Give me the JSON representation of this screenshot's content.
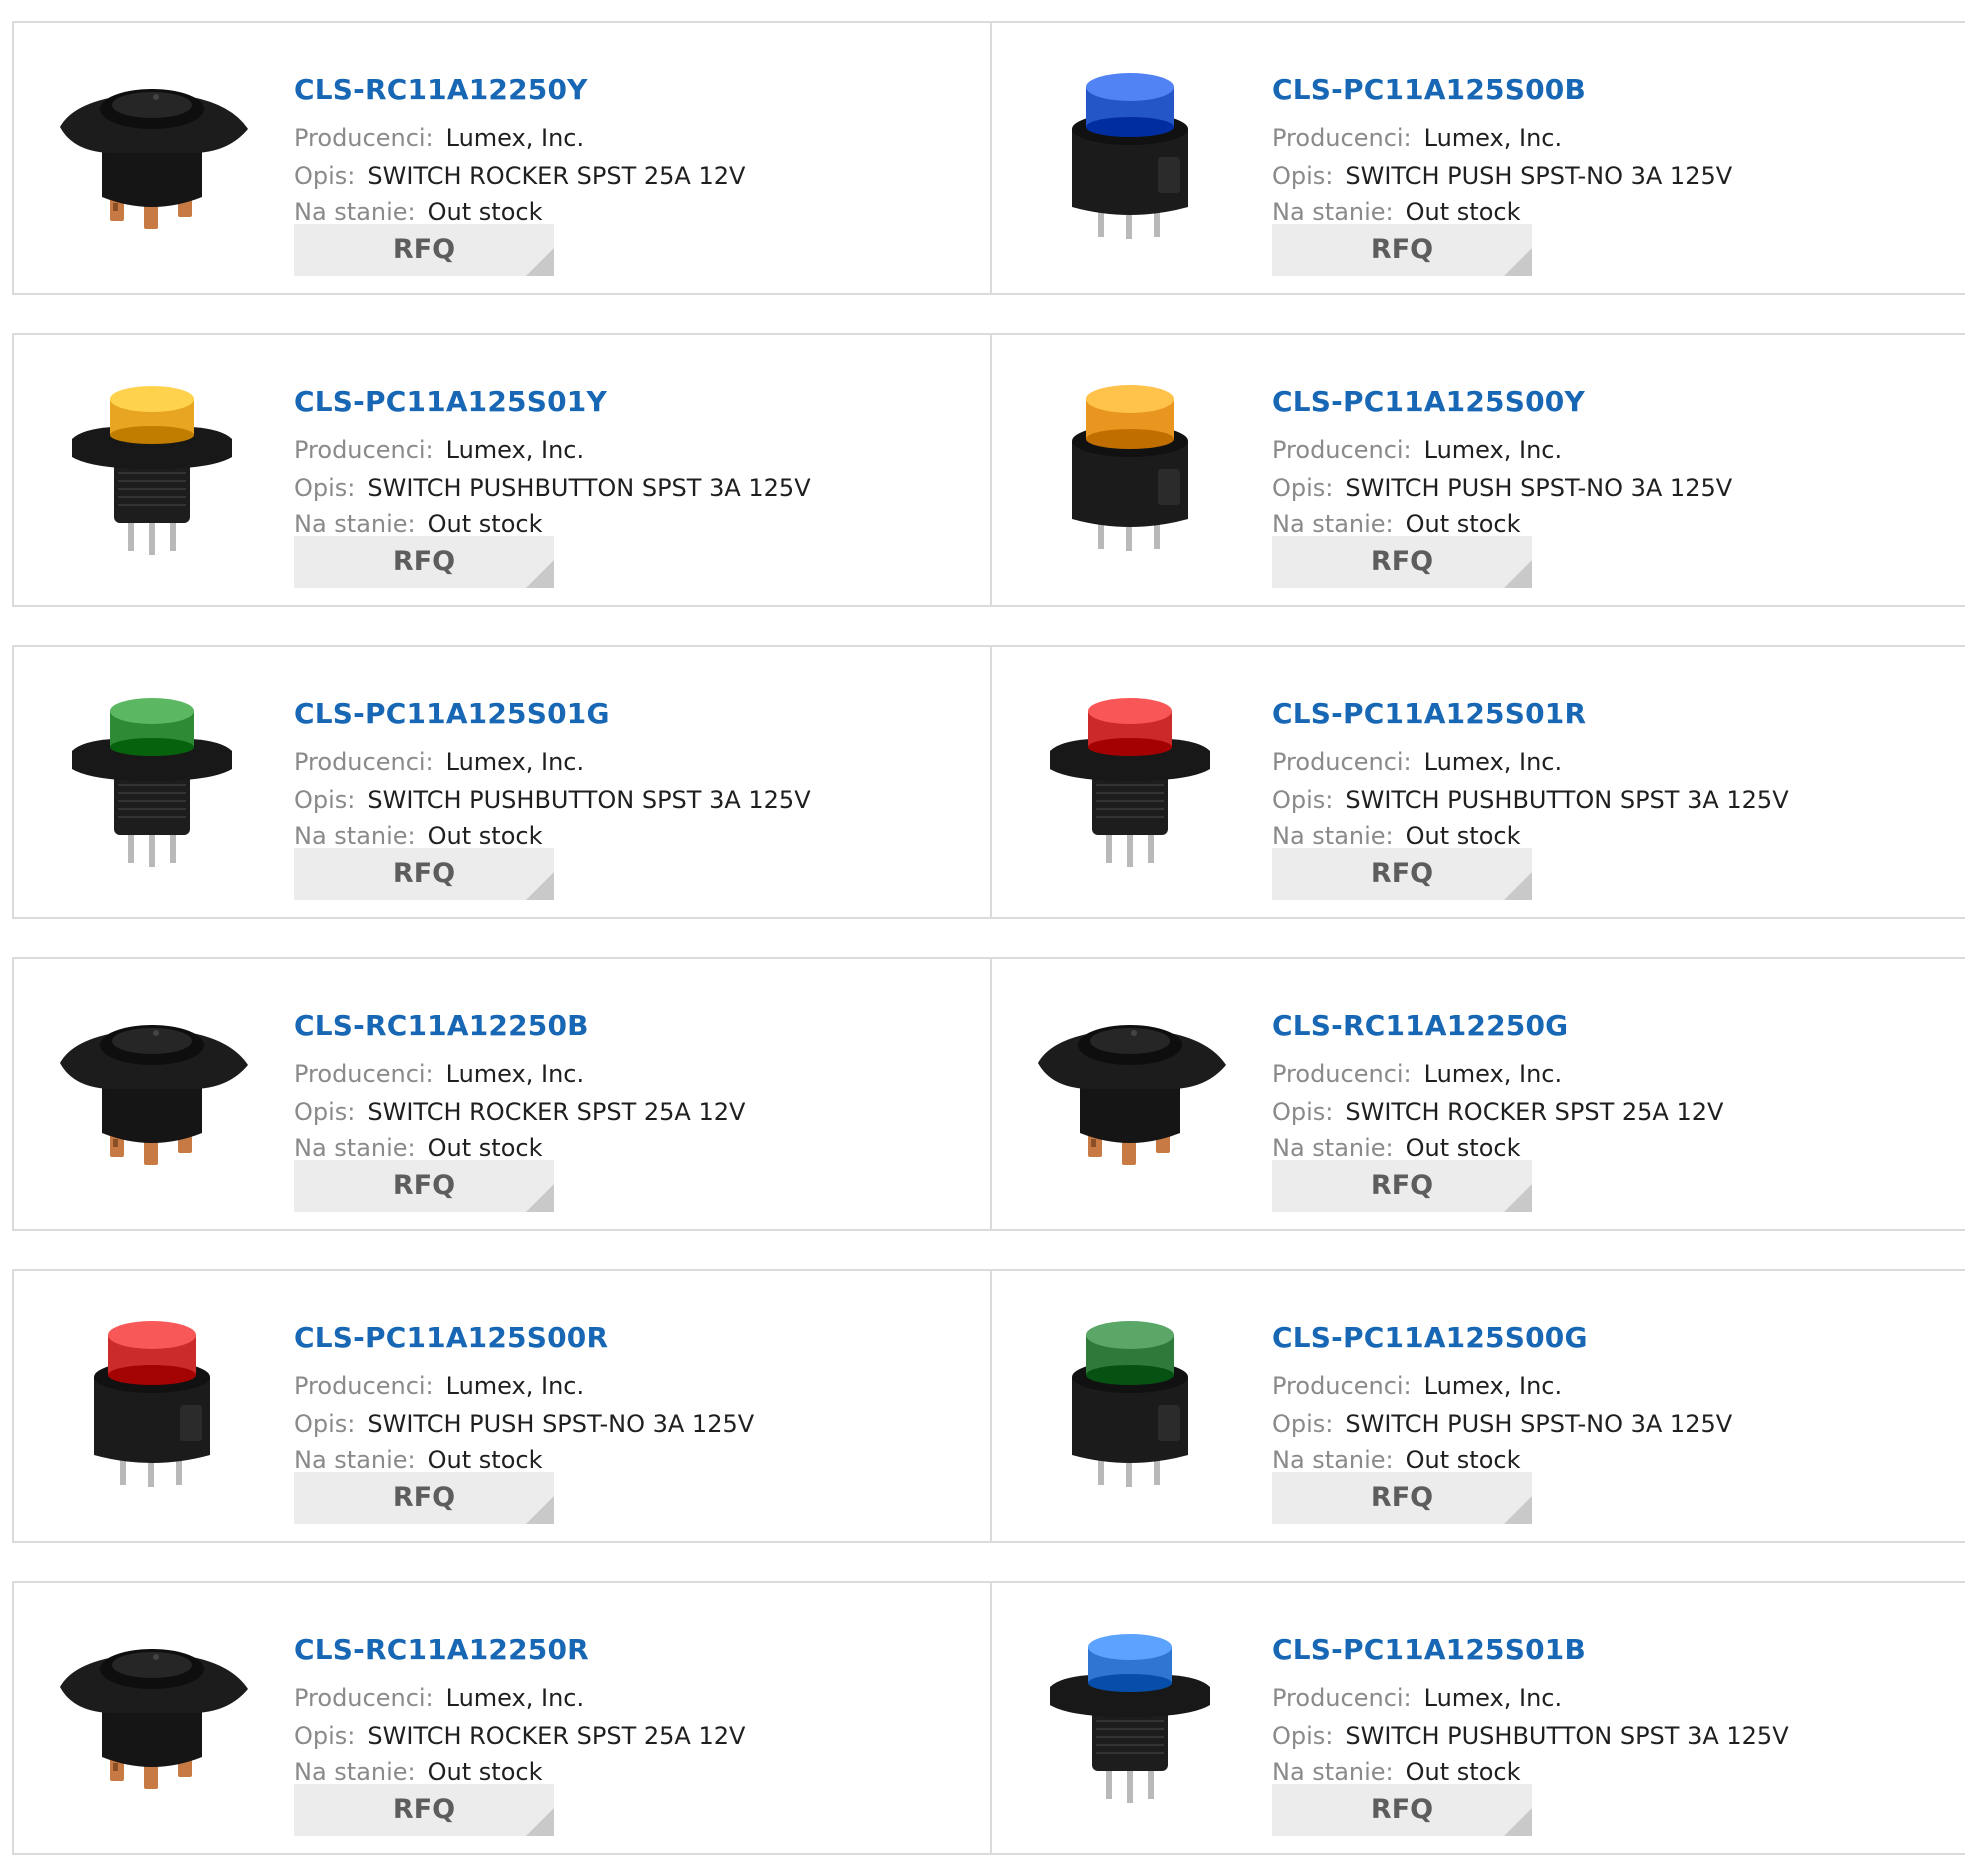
{
  "labels": {
    "manufacturer": "Producenci:",
    "description": "Opis:",
    "stock": "Na stanie:",
    "rfq": "RFQ"
  },
  "products": [
    {
      "part": "CLS-RC11A12250Y",
      "manufacturer": "Lumex, Inc.",
      "description": "SWITCH ROCKER SPST 25A 12V",
      "stock": "Out stock",
      "image": "rocker-switch-icon",
      "cap_color": "#1a1a1a"
    },
    {
      "part": "CLS-PC11A125S00B",
      "manufacturer": "Lumex, Inc.",
      "description": "SWITCH PUSH SPST-NO 3A 125V",
      "stock": "Out stock",
      "image": "push-switch-icon",
      "cap_color": "#2456c8"
    },
    {
      "part": "CLS-PC11A125S01Y",
      "manufacturer": "Lumex, Inc.",
      "description": "SWITCH PUSHBUTTON SPST 3A 125V",
      "stock": "Out stock",
      "image": "pushbutton-switch-icon",
      "cap_color": "#e8a521"
    },
    {
      "part": "CLS-PC11A125S00Y",
      "manufacturer": "Lumex, Inc.",
      "description": "SWITCH PUSH SPST-NO 3A 125V",
      "stock": "Out stock",
      "image": "push-switch-icon",
      "cap_color": "#e8961f"
    },
    {
      "part": "CLS-PC11A125S01G",
      "manufacturer": "Lumex, Inc.",
      "description": "SWITCH PUSHBUTTON SPST 3A 125V",
      "stock": "Out stock",
      "image": "pushbutton-switch-icon",
      "cap_color": "#2f8a35"
    },
    {
      "part": "CLS-PC11A125S01R",
      "manufacturer": "Lumex, Inc.",
      "description": "SWITCH PUSHBUTTON SPST 3A 125V",
      "stock": "Out stock",
      "image": "pushbutton-switch-icon",
      "cap_color": "#cc2a2a"
    },
    {
      "part": "CLS-RC11A12250B",
      "manufacturer": "Lumex, Inc.",
      "description": "SWITCH ROCKER SPST 25A 12V",
      "stock": "Out stock",
      "image": "rocker-switch-icon",
      "cap_color": "#1a1a1a"
    },
    {
      "part": "CLS-RC11A12250G",
      "manufacturer": "Lumex, Inc.",
      "description": "SWITCH ROCKER SPST 25A 12V",
      "stock": "Out stock",
      "image": "rocker-switch-icon",
      "cap_color": "#1a1a1a"
    },
    {
      "part": "CLS-PC11A125S00R",
      "manufacturer": "Lumex, Inc.",
      "description": "SWITCH PUSH SPST-NO 3A 125V",
      "stock": "Out stock",
      "image": "push-switch-icon",
      "cap_color": "#cc2b2b"
    },
    {
      "part": "CLS-PC11A125S00G",
      "manufacturer": "Lumex, Inc.",
      "description": "SWITCH PUSH SPST-NO 3A 125V",
      "stock": "Out stock",
      "image": "push-switch-icon",
      "cap_color": "#2d7a3a"
    },
    {
      "part": "CLS-RC11A12250R",
      "manufacturer": "Lumex, Inc.",
      "description": "SWITCH ROCKER SPST 25A 12V",
      "stock": "Out stock",
      "image": "rocker-switch-icon",
      "cap_color": "#1a1a1a"
    },
    {
      "part": "CLS-PC11A125S01B",
      "manufacturer": "Lumex, Inc.",
      "description": "SWITCH PUSHBUTTON SPST 3A 125V",
      "stock": "Out stock",
      "image": "pushbutton-switch-icon",
      "cap_color": "#2f76d2"
    }
  ]
}
